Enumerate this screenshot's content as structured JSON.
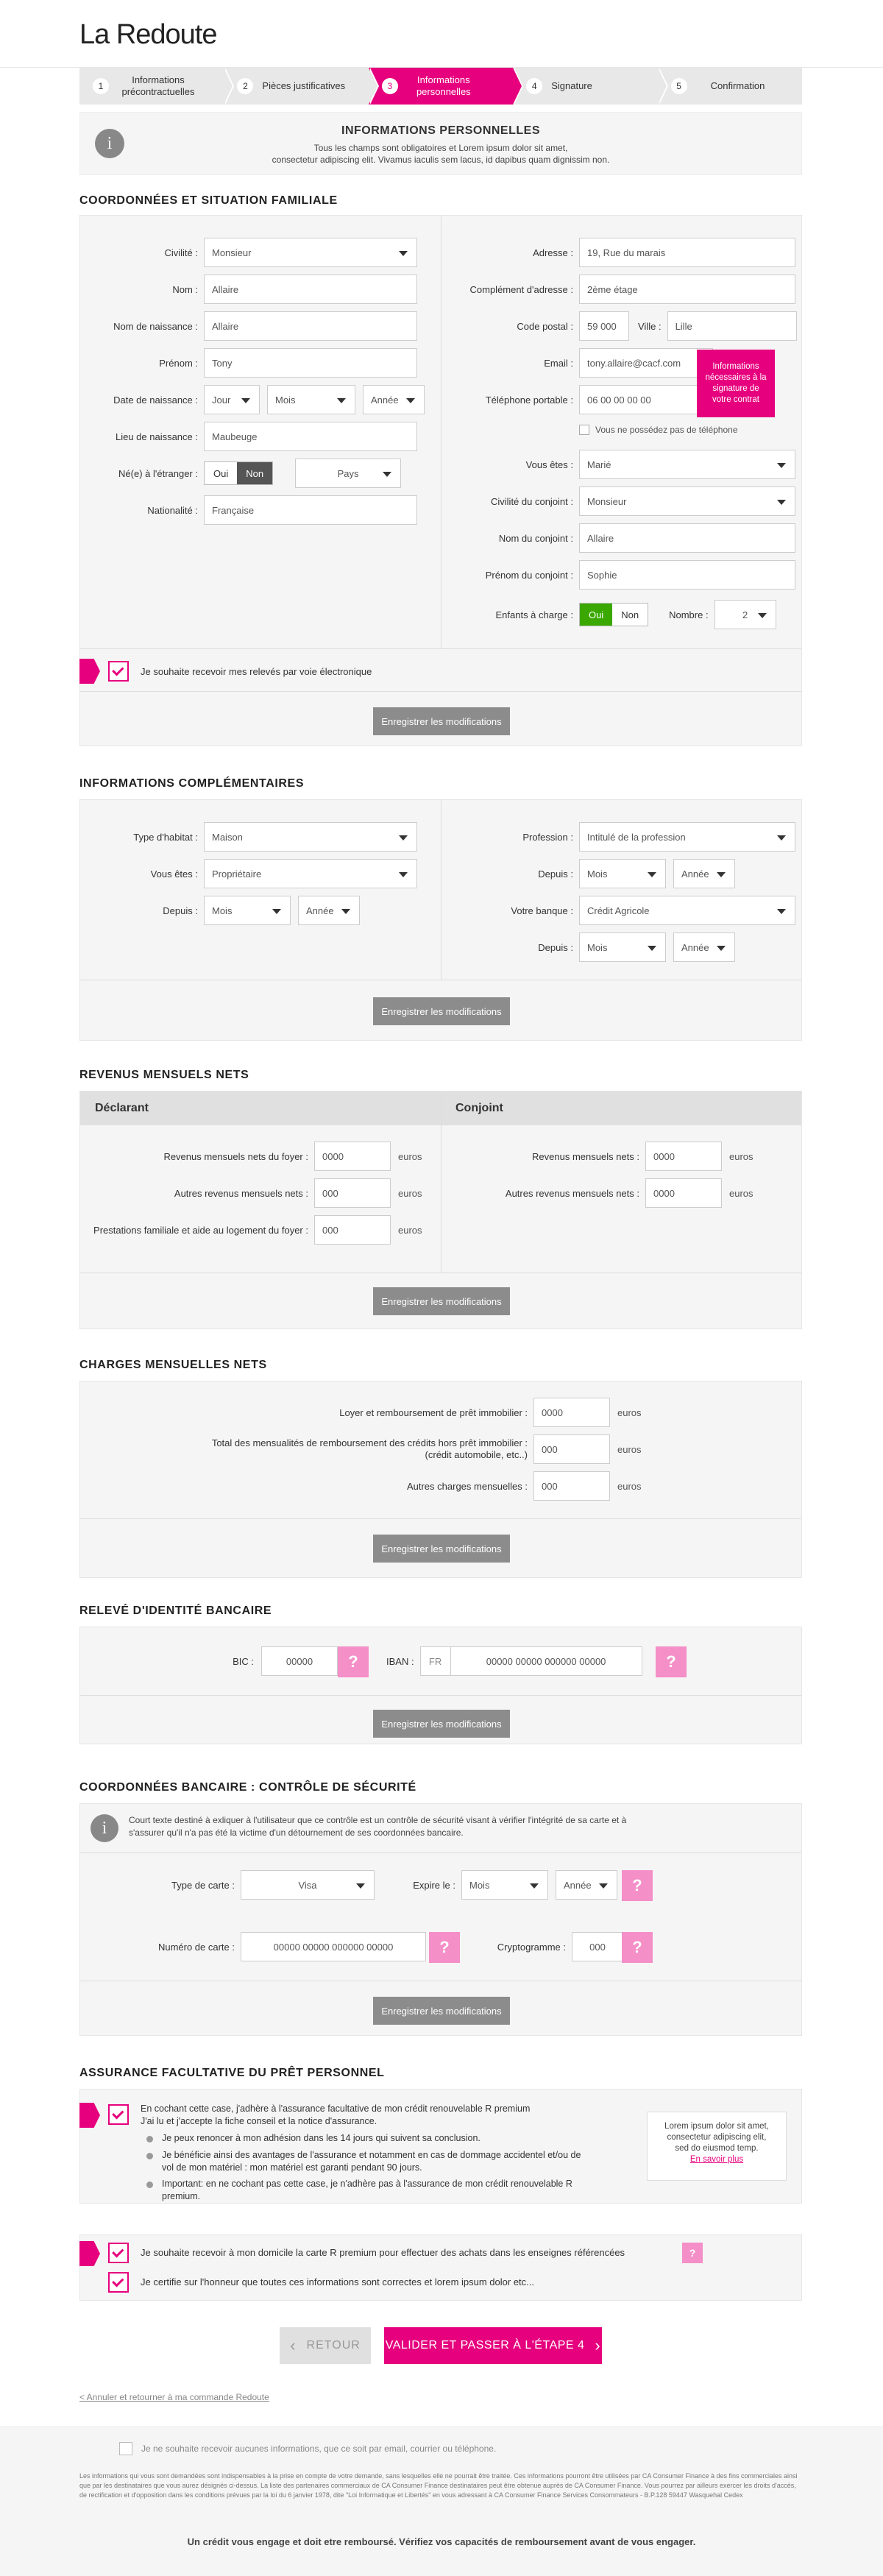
{
  "brand": "La Redoute",
  "steps": [
    {
      "num": "1",
      "label": "Informations précontractuelles"
    },
    {
      "num": "2",
      "label": "Pièces justificatives"
    },
    {
      "num": "3",
      "label": "Informations personnelles"
    },
    {
      "num": "4",
      "label": "Signature"
    },
    {
      "num": "5",
      "label": "Confirmation"
    }
  ],
  "colors": {
    "accent": "#e6007e",
    "button_grey": "#8c8c8c",
    "panel_bg": "#f5f5f5",
    "green": "#3aa800"
  },
  "intro": {
    "title": "INFORMATIONS PERSONNELLES",
    "line1": "Tous les champs sont obligatoires et Lorem ipsum dolor sit amet,",
    "line2": "consectetur adipiscing elit. Vivamus iaculis sem lacus, id dapibus quam dignissim non."
  },
  "coord": {
    "title": "COORDONNÉES ET SITUATION FAMILIALE",
    "civilite": {
      "label": "Civilité :",
      "value": "Monsieur"
    },
    "nom": {
      "label": "Nom :",
      "value": "Allaire"
    },
    "nom_naissance": {
      "label": "Nom de naissance :",
      "value": "Allaire"
    },
    "prenom": {
      "label": "Prénom :",
      "value": "Tony"
    },
    "date_naissance": {
      "label": "Date de naissance :",
      "jour": "Jour",
      "mois": "Mois",
      "annee": "Année"
    },
    "lieu_naissance": {
      "label": "Lieu de naissance :",
      "value": "Maubeuge"
    },
    "etranger": {
      "label": "Né(e) à l'étranger :",
      "oui": "Oui",
      "non": "Non",
      "pays": "Pays"
    },
    "nationalite": {
      "label": "Nationalité :",
      "value": "Française"
    },
    "adresse": {
      "label": "Adresse :",
      "value": "19, Rue du marais"
    },
    "complement": {
      "label": "Complément d'adresse :",
      "value": "2ème étage"
    },
    "code_postal": {
      "label": "Code postal :",
      "value": "59 000"
    },
    "ville": {
      "label": "Ville :",
      "value": "Lille"
    },
    "email": {
      "label": "Email :",
      "value": "tony.allaire@cacf.com"
    },
    "telephone": {
      "label": "Téléphone portable :",
      "value": "06 00 00 00 00"
    },
    "no_phone": "Vous ne possédez pas de téléphone",
    "tooltip": "Informations nécessaires à la signature de votre contrat",
    "vous_etes": {
      "label": "Vous êtes :",
      "value": "Marié"
    },
    "civ_conjoint": {
      "label": "Civilité du conjoint :",
      "value": "Monsieur"
    },
    "nom_conjoint": {
      "label": "Nom du conjoint :",
      "value": "Allaire"
    },
    "prenom_conjoint": {
      "label": "Prénom du conjoint :",
      "value": "Sophie"
    },
    "enfants": {
      "label": "Enfants à charge :",
      "oui": "Oui",
      "non": "Non",
      "nombre_label": "Nombre :",
      "nombre": "2"
    },
    "releves": "Je souhaite recevoir mes relevés par voie électronique",
    "save": "Enregistrer les modifications"
  },
  "compl": {
    "title": "INFORMATIONS COMPLÉMENTAIRES",
    "habitat": {
      "label": "Type d'habitat :",
      "value": "Maison"
    },
    "statut": {
      "label": "Vous êtes :",
      "value": "Propriétaire"
    },
    "depuis": {
      "label": "Depuis :",
      "mois": "Mois",
      "annee": "Année"
    },
    "profession": {
      "label": "Profession :",
      "value": "Intitulé de la profession"
    },
    "depuis2": {
      "label": "Depuis :",
      "mois": "Mois",
      "annee": "Année"
    },
    "banque": {
      "label": "Votre banque :",
      "value": "Crédit Agricole"
    },
    "depuis3": {
      "label": "Depuis :",
      "mois": "Mois",
      "annee": "Année"
    },
    "save": "Enregistrer les modifications"
  },
  "revenus": {
    "title": "REVENUS MENSUELS NETS",
    "declarant": "Déclarant",
    "conjoint": "Conjoint",
    "r1": {
      "label": "Revenus mensuels nets du foyer :",
      "value": "0000",
      "unit": "euros"
    },
    "r2": {
      "label": "Autres revenus mensuels nets :",
      "value": "000",
      "unit": "euros"
    },
    "r3": {
      "label": "Prestations familiale et aide au logement du foyer :",
      "value": "000",
      "unit": "euros"
    },
    "c1": {
      "label": "Revenus mensuels nets :",
      "value": "0000",
      "unit": "euros"
    },
    "c2": {
      "label": "Autres revenus mensuels nets :",
      "value": "0000",
      "unit": "euros"
    },
    "save": "Enregistrer les modifications"
  },
  "charges": {
    "title": "CHARGES MENSUELLES NETS",
    "c1": {
      "label": "Loyer et remboursement de prêt immobilier :",
      "value": "0000",
      "unit": "euros"
    },
    "c2": {
      "label1": "Total des mensualités de remboursement des crédits hors prêt immobilier :",
      "label2": "(crédit automobile, etc..)",
      "value": "000",
      "unit": "euros"
    },
    "c3": {
      "label": "Autres charges mensuelles :",
      "value": "000",
      "unit": "euros"
    },
    "save": "Enregistrer les modifications"
  },
  "rib": {
    "title": "RELEVÉ D'IDENTITÉ BANCAIRE",
    "bic_label": "BIC :",
    "bic": "00000",
    "iban_label": "IBAN :",
    "iban_prefix": "FR",
    "iban": "00000 00000 000000 00000",
    "help": "?",
    "save": "Enregistrer les modifications"
  },
  "securite": {
    "title": "COORDONNÉES BANCAIRE : CONTRÔLE DE SÉCURITÉ",
    "info1": "Court texte destiné à exliquer à l'utilisateur que ce contrôle est un contrôle de sécurité visant à vérifier l'intégrité de sa carte et à",
    "info2": "s'assurer qu'il n'a pas été la victime d'un détournement de ses coordonnées bancaire.",
    "type_label": "Type de carte :",
    "type": "Visa",
    "expire_label": "Expire le :",
    "mois": "Mois",
    "annee": "Année",
    "numero_label": "Numéro de carte :",
    "numero": "00000 00000 000000 00000",
    "crypto_label": "Cryptogramme :",
    "crypto": "000",
    "help": "?",
    "save": "Enregistrer les modifications"
  },
  "assurance": {
    "title": "ASSURANCE FACULTATIVE DU PRÊT PERSONNEL",
    "line1": "En cochant cette case, j'adhère à l'assurance facultative de mon crédit renouvelable R premium",
    "line2": "J'ai lu et j'accepte la fiche conseil et la notice d'assurance.",
    "b1": "Je peux renoncer à mon adhésion dans les 14 jours qui suivent sa conclusion.",
    "b2": "Je bénéficie ainsi des avantages de l'assurance et notamment en cas de dommage accidentel et/ou de vol de mon matériel : mon matériel est garanti pendant 90 jours.",
    "b3": "Important: en ne cochant pas cette case, je n'adhère pas à l'assurance de mon crédit renouvelable R premium.",
    "side1": "Lorem ipsum dolor sit amet,",
    "side2": "consectetur adipiscing elit,",
    "side3": "sed do eiusmod temp.",
    "side_link": "En savoir plus"
  },
  "final": {
    "carte": "Je souhaite recevoir à mon domicile la carte R premium pour effectuer des achats dans les enseignes référencées",
    "certifie": "Je certifie sur l'honneur que toutes ces informations sont correctes et lorem ipsum dolor etc...",
    "help": "?",
    "retour": "RETOUR",
    "valider": "VALIDER ET PASSER À L'ÉTAPE 4",
    "annuler": "< Annuler et retourner à ma commande Redoute"
  },
  "footer": {
    "optout": "Je ne souhaite recevoir aucunes informations, que ce soit par email, courrier ou téléphone.",
    "legal": "Les informations qui vous sont demandées sont indispensables à la prise en compte de votre demande, sans lesquelles elle ne pourrait être traitée. Ces informations pourront être utilisées par CA Consumer Finance à des fins commerciales ainsi que par les destinataires que vous aurez désignés ci-dessus. La liste des partenaires commerciaux de CA Consumer Finance destinataires peut être obtenue auprès de CA Consumer Finance. Vous pourrez par ailleurs exercer les droits d'accès, de rectification et d'opposition dans les conditions prévues par la loi du 6 janvier 1978, dite \"Loi Informatique et Libertés\" en vous adressant à CA Consumer Finance Services Consommateurs - B.P.128 59447 Wasquehal Cedex",
    "warning": "Un crédit vous engage et doit etre remboursé. Vérifiez vos capacités de remboursement avant de vous engager."
  }
}
